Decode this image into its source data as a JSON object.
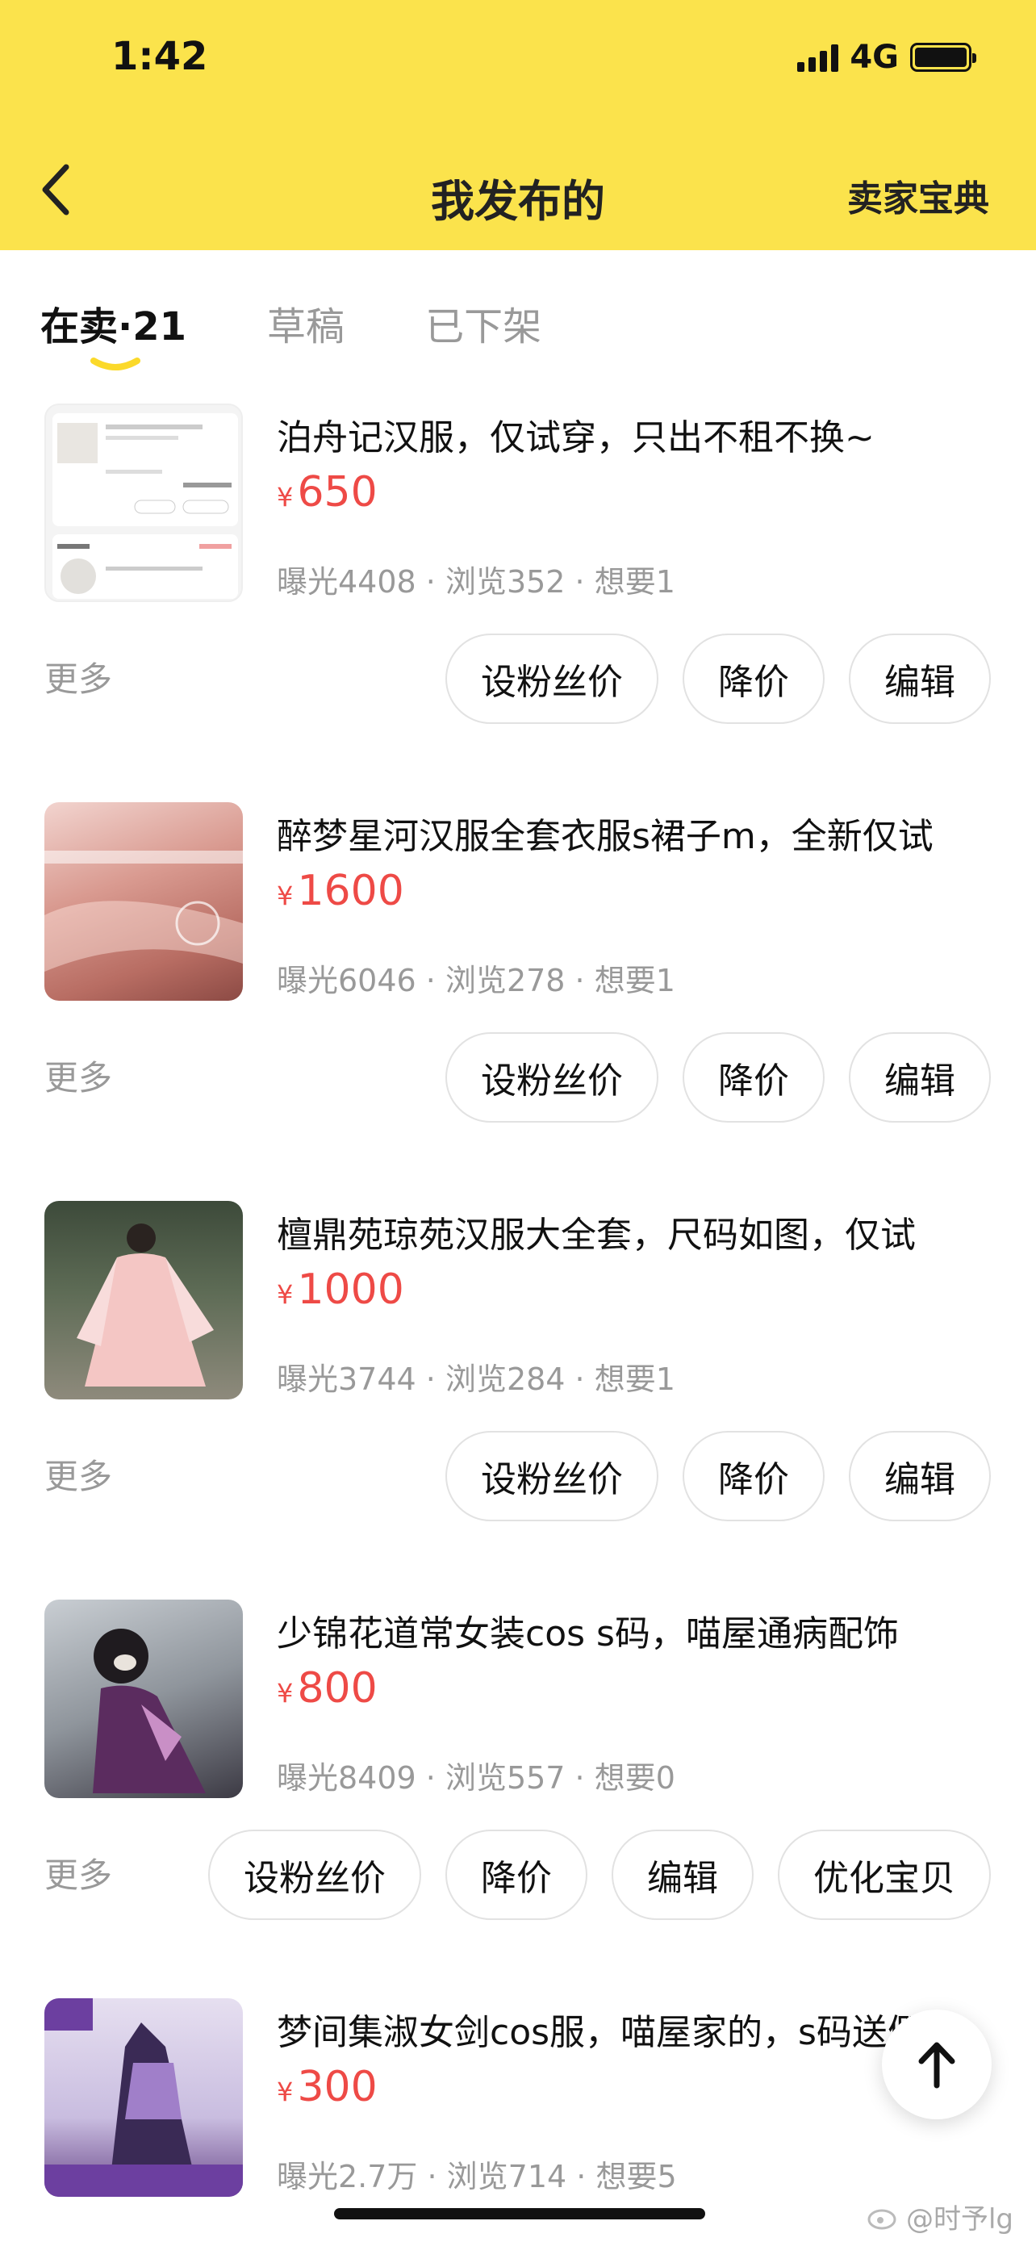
{
  "status_bar": {
    "time": "1:42",
    "network": "4G"
  },
  "header": {
    "title": "我发布的",
    "right_link": "卖家宝典"
  },
  "tabs": [
    {
      "label": "在卖·21",
      "active": true
    },
    {
      "label": "草稿",
      "active": false
    },
    {
      "label": "已下架",
      "active": false
    }
  ],
  "listings": [
    {
      "title": "泊舟记汉服，仅试穿，只出不租不换~",
      "price_symbol": "¥",
      "price": "650",
      "stats": "曝光4408 · 浏览352 · 想要1",
      "more": "更多",
      "actions": [
        "设粉丝价",
        "降价",
        "编辑"
      ]
    },
    {
      "title": "醉梦星河汉服全套衣服s裙子m，全新仅试",
      "price_symbol": "¥",
      "price": "1600",
      "stats": "曝光6046 · 浏览278 · 想要1",
      "more": "更多",
      "actions": [
        "设粉丝价",
        "降价",
        "编辑"
      ]
    },
    {
      "title": "檀鼎苑琼苑汉服大全套，尺码如图，仅试",
      "price_symbol": "¥",
      "price": "1000",
      "stats": "曝光3744 · 浏览284 · 想要1",
      "more": "更多",
      "actions": [
        "设粉丝价",
        "降价",
        "编辑"
      ]
    },
    {
      "title": "少锦花道常女装cos s码，喵屋通病配饰",
      "price_symbol": "¥",
      "price": "800",
      "stats": "曝光8409 · 浏览557 · 想要0",
      "more": "更多",
      "actions": [
        "设粉丝价",
        "降价",
        "编辑",
        "优化宝贝"
      ]
    },
    {
      "title": "梦间集淑女剑cos服，喵屋家的，s码送假",
      "price_symbol": "¥",
      "price": "300",
      "stats": "曝光2.7万 · 浏览714 · 想要5"
    }
  ],
  "watermark": "@时予lg",
  "colors": {
    "header_bg": "#fbe34c",
    "price": "#ee4a46",
    "muted": "#999999"
  },
  "icons": {
    "back": "chevron-left-icon",
    "scroll_top": "arrow-up-icon"
  }
}
